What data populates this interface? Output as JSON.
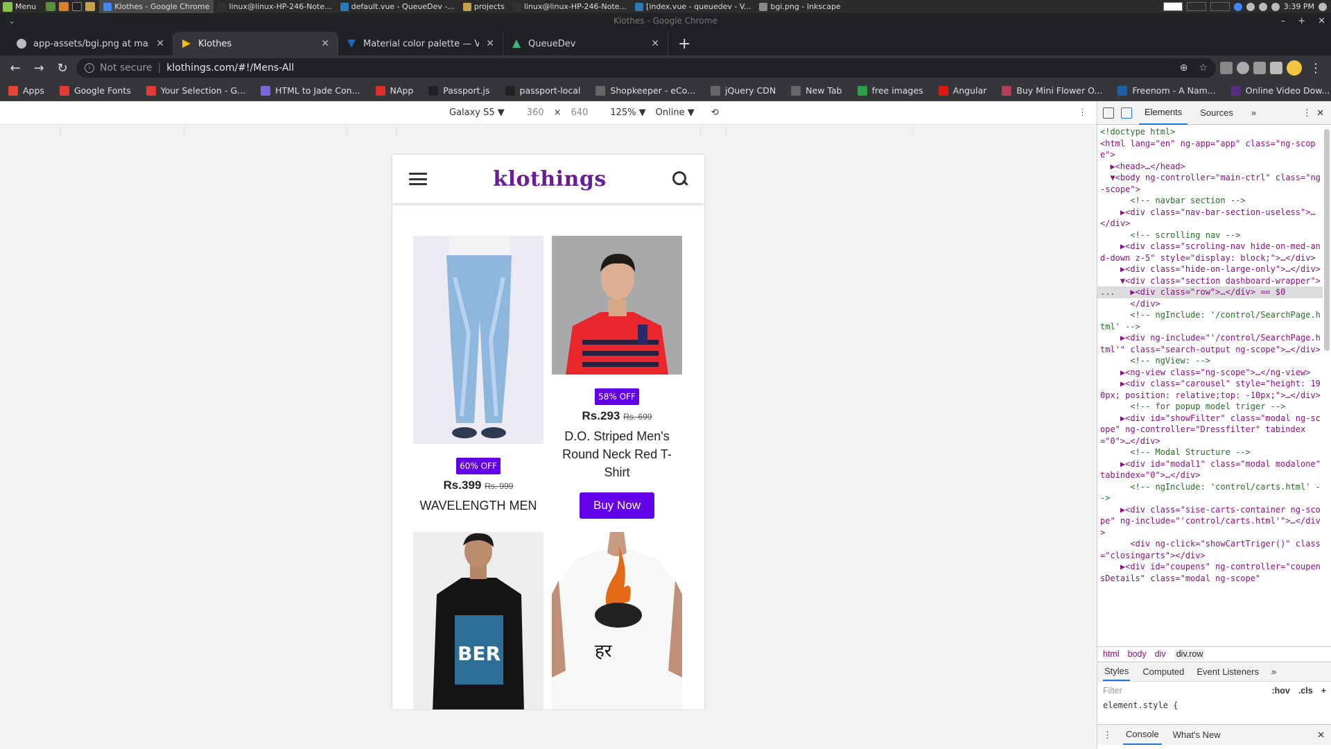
{
  "taskbar": {
    "menu_label": "Menu",
    "tasks": [
      {
        "label": "Klothes - Google Chrome",
        "active": true,
        "color": "#4285f4"
      },
      {
        "label": "linux@linux-HP-246-Note...",
        "active": false,
        "color": "#333"
      },
      {
        "label": "default.vue - QueueDev -...",
        "active": false,
        "color": "#2a7ab8"
      },
      {
        "label": "projects",
        "active": false,
        "color": "#c9a04a"
      },
      {
        "label": "linux@linux-HP-246-Note...",
        "active": false,
        "color": "#333"
      },
      {
        "label": "[index.vue - queuedev - V...",
        "active": false,
        "color": "#2a7ab8"
      },
      {
        "label": "bgi.png - Inkscape",
        "active": false,
        "color": "#888"
      }
    ],
    "clock": "3:39 PM"
  },
  "window": {
    "title": "Klothes - Google Chrome"
  },
  "tabs": [
    {
      "label": "app-assets/bgi.png at master ·",
      "active": false,
      "icon": "github-icon"
    },
    {
      "label": "Klothes",
      "active": true,
      "icon": "klothes-icon"
    },
    {
      "label": "Material color palette — Vuetify",
      "active": false,
      "icon": "vuetify-icon"
    },
    {
      "label": "QueueDev",
      "active": false,
      "icon": "queuedev-icon"
    }
  ],
  "omnibox": {
    "security": "Not secure",
    "url": "klothings.com/#!/Mens-All"
  },
  "bookmarks": [
    {
      "label": "Apps",
      "color": "#ea4335"
    },
    {
      "label": "Google Fonts",
      "color": "#e53935"
    },
    {
      "label": "Your Selection - G...",
      "color": "#e53935"
    },
    {
      "label": "HTML to Jade Con...",
      "color": "#7a6ad8"
    },
    {
      "label": "NApp",
      "color": "#dd2c2c"
    },
    {
      "label": "Passport.js",
      "color": "#222"
    },
    {
      "label": "passport-local",
      "color": "#222"
    },
    {
      "label": "Shopkeeper - eCo...",
      "color": "#666"
    },
    {
      "label": "jQuery CDN",
      "color": "#666"
    },
    {
      "label": "New Tab",
      "color": "#666"
    },
    {
      "label": "free images",
      "color": "#2e9e4b"
    },
    {
      "label": "Angular",
      "color": "#dd1b16"
    },
    {
      "label": "Buy Mini Flower O...",
      "color": "#b53c5a"
    },
    {
      "label": "Freenom - A Nam...",
      "color": "#1e5fa8"
    },
    {
      "label": "Online Video Dow...",
      "color": "#5a2d82"
    }
  ],
  "device_bar": {
    "device": "Galaxy S5 ▼",
    "width": "360",
    "times": "×",
    "height": "640",
    "zoom": "125% ▼",
    "network": "Online ▼"
  },
  "site": {
    "brand": "klothings",
    "brand_color": "#6a1b9a",
    "accent": "#6200ea",
    "products": [
      {
        "badge": "60% OFF",
        "price": "Rs.399",
        "mrp": "Rs. 999",
        "name": "WAVELENGTH MEN SKINNY FIT",
        "image": "jeans",
        "buy": ""
      },
      {
        "badge": "58% OFF",
        "price": "Rs.293",
        "mrp": "Rs. 699",
        "name": "D.O. Striped Men's Round Neck Red T-Shirt",
        "image": "red-tshirt",
        "buy": "Buy Now"
      },
      {
        "badge": "",
        "price": "",
        "mrp": "",
        "name": "",
        "image": "black-tshirt",
        "buy": ""
      },
      {
        "badge": "",
        "price": "",
        "mrp": "",
        "name": "",
        "image": "white-tshirt",
        "buy": ""
      }
    ]
  },
  "devtools": {
    "tabs": [
      "Elements",
      "Sources",
      "»"
    ],
    "breadcrumbs": [
      "html",
      "body",
      "div",
      "div.row"
    ],
    "styles_tabs": [
      "Styles",
      "Computed",
      "Event Listeners",
      "»"
    ],
    "filter_placeholder": "Filter",
    "filter_hov": ":hov",
    "filter_cls": ".cls",
    "filter_plus": "+",
    "element_style": "element.style {",
    "console_tabs": [
      "Console",
      "What's New"
    ],
    "dom_lines": [
      {
        "text": "<!doctype html>",
        "kind": "com"
      },
      {
        "text": "<html lang=\"en\" ng-app=\"app\" class=\"ng-scope\">",
        "kind": "tag"
      },
      {
        "text": "  ▶<head>…</head>",
        "kind": "tag"
      },
      {
        "text": "  ▼<body ng-controller=\"main-ctrl\" class=\"ng-scope\">",
        "kind": "tag"
      },
      {
        "text": "      <!-- navbar section -->",
        "kind": "com"
      },
      {
        "text": "    ▶<div class=\"nav-bar-section-useless\">…</div>",
        "kind": "tag"
      },
      {
        "text": "      <!-- scrolling nav -->",
        "kind": "com"
      },
      {
        "text": "    ▶<div class=\"scroling-nav hide-on-med-and-down z-5\" style=\"display: block;\">…</div>",
        "kind": "tag"
      },
      {
        "text": "    ▶<div class=\"hide-on-large-only\">…</div>",
        "kind": "tag"
      },
      {
        "text": "    ▼<div class=\"section dashboard-wrapper\">",
        "kind": "tag"
      },
      {
        "text": "...   ▶<div class=\"row\">…</div> == $0",
        "kind": "sel"
      },
      {
        "text": "      </div>",
        "kind": "tag"
      },
      {
        "text": "      <!-- ngInclude: '/control/SearchPage.html' -->",
        "kind": "com"
      },
      {
        "text": "    ▶<div ng-include=\"'/control/SearchPage.html'\" class=\"search-output ng-scope\">…</div>",
        "kind": "tag"
      },
      {
        "text": "      <!-- ngView: -->",
        "kind": "com"
      },
      {
        "text": "    ▶<ng-view class=\"ng-scope\">…</ng-view>",
        "kind": "tag"
      },
      {
        "text": "    ▶<div class=\"carousel\" style=\"height: 190px; position: relative;top: -10px;\">…</div>",
        "kind": "tag"
      },
      {
        "text": "      <!-- for popup model triger -->",
        "kind": "com"
      },
      {
        "text": "    ▶<div id=\"showFilter\" class=\"modal ng-scope\" ng-controller=\"Dressfilter\" tabindex=\"0\">…</div>",
        "kind": "tag"
      },
      {
        "text": "      <!-- Modal Structure -->",
        "kind": "com"
      },
      {
        "text": "    ▶<div id=\"modal1\" class=\"modal modalone\" tabindex=\"0\">…</div>",
        "kind": "tag"
      },
      {
        "text": "      <!-- ngInclude: 'control/carts.html' -->",
        "kind": "com"
      },
      {
        "text": "    ▶<div class=\"sise-carts-container ng-scope\" ng-include=\"'control/carts.html'\">…</div>",
        "kind": "tag"
      },
      {
        "text": "      <div ng-click=\"showCartTriger()\" class=\"closingarts\"></div>",
        "kind": "tag"
      },
      {
        "text": "    ▶<div id=\"coupens\" ng-controller=\"coupensDetails\" class=\"modal ng-scope\"",
        "kind": "tag"
      }
    ]
  }
}
